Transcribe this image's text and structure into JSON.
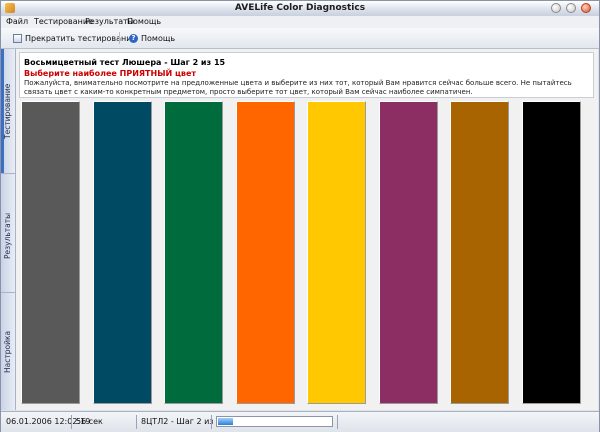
{
  "window": {
    "title": "AVELife Color Diagnostics"
  },
  "menu": {
    "items": [
      "Файл",
      "Тестирование",
      "Результаты",
      "Помощь"
    ]
  },
  "toolbar": {
    "stop_label": "Прекратить тестирование",
    "help_label": "Помощь"
  },
  "sidebar": {
    "tabs": [
      "Тестирование",
      "Результаты",
      "Настройка"
    ]
  },
  "info": {
    "title": "Восьмицветный тест Люшера - Шаг 2 из 15",
    "subtitle": "Выберите наиболее ПРИЯТНЫЙ цвет",
    "text": "Пожалуйста, внимательно посмотрите на предложенные цвета и выберите из них тот, который Вам нравится сейчас больше всего. Не пытайтесь связать цвет с каким-то конкретным предметом, просто выберите тот цвет, который Вам сейчас наиболее симпатичен."
  },
  "swatches": {
    "colors": [
      "#595959",
      "#004b63",
      "#006b3c",
      "#ff6600",
      "#ffc800",
      "#8c2d63",
      "#a86400",
      "#000000"
    ]
  },
  "status": {
    "datetime": "06.01.2006 12:02:19",
    "elapsed": "56 сек",
    "step": "8ЦТЛ2 - Шаг 2 из 15",
    "progress": 0.13
  }
}
